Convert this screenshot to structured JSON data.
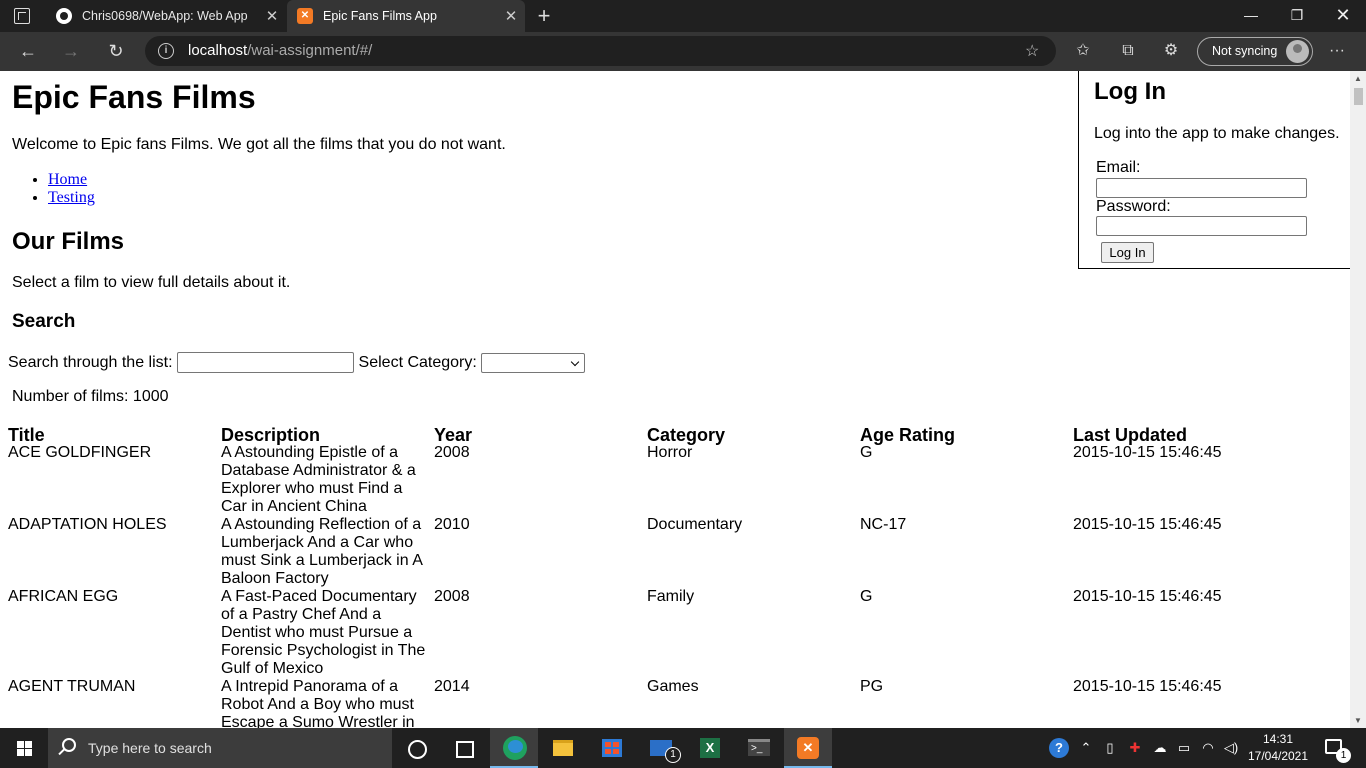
{
  "browser": {
    "tabs": [
      {
        "title": "Chris0698/WebApp: Web App",
        "favicon": "github-icon"
      },
      {
        "title": "Epic Fans Films App",
        "favicon": "xampp-icon"
      }
    ],
    "url_host": "localhost",
    "url_path": "/wai-assignment/#/",
    "sync_label": "Not syncing"
  },
  "site": {
    "title": "Epic Fans Films",
    "welcome": "Welcome to Epic fans Films. We got all the films that you do not want.",
    "nav": [
      "Home",
      "Testing"
    ],
    "films_heading": "Our Films",
    "films_sub": "Select a film to view full details about it.",
    "search_heading": "Search",
    "search_label": "Search through the list:",
    "search_value": "",
    "category_label": "Select Category:",
    "category_value": "",
    "count_text": "Number of films: 1000"
  },
  "login": {
    "title": "Log In",
    "description": "Log into the app to make changes.",
    "email_label": "Email:",
    "password_label": "Password:",
    "button": "Log In"
  },
  "table": {
    "headers": [
      "Title",
      "Description",
      "Year",
      "Category",
      "Age Rating",
      "Last Updated"
    ],
    "rows": [
      [
        "ACE GOLDFINGER",
        "A Astounding Epistle of a Database Administrator & a Explorer who must Find a Car in Ancient China",
        "2008",
        "Horror",
        "G",
        "2015-10-15 15:46:45"
      ],
      [
        "ADAPTATION HOLES",
        "A Astounding Reflection of a Lumberjack And a Car who must Sink a Lumberjack in A Baloon Factory",
        "2010",
        "Documentary",
        "NC-17",
        "2015-10-15 15:46:45"
      ],
      [
        "AFRICAN EGG",
        "A Fast-Paced Documentary of a Pastry Chef And a Dentist who must Pursue a Forensic Psychologist in The Gulf of Mexico",
        "2008",
        "Family",
        "G",
        "2015-10-15 15:46:45"
      ],
      [
        "AGENT TRUMAN",
        "A Intrepid Panorama of a Robot And a Boy who must Escape a Sumo Wrestler in Ancient China",
        "2014",
        "Games",
        "PG",
        "2015-10-15 15:46:45"
      ]
    ]
  },
  "taskbar": {
    "search_placeholder": "Type here to search",
    "mail_badge": "1",
    "excel_letter": "X",
    "time": "14:31",
    "date": "17/04/2021",
    "notification_count": "1"
  }
}
